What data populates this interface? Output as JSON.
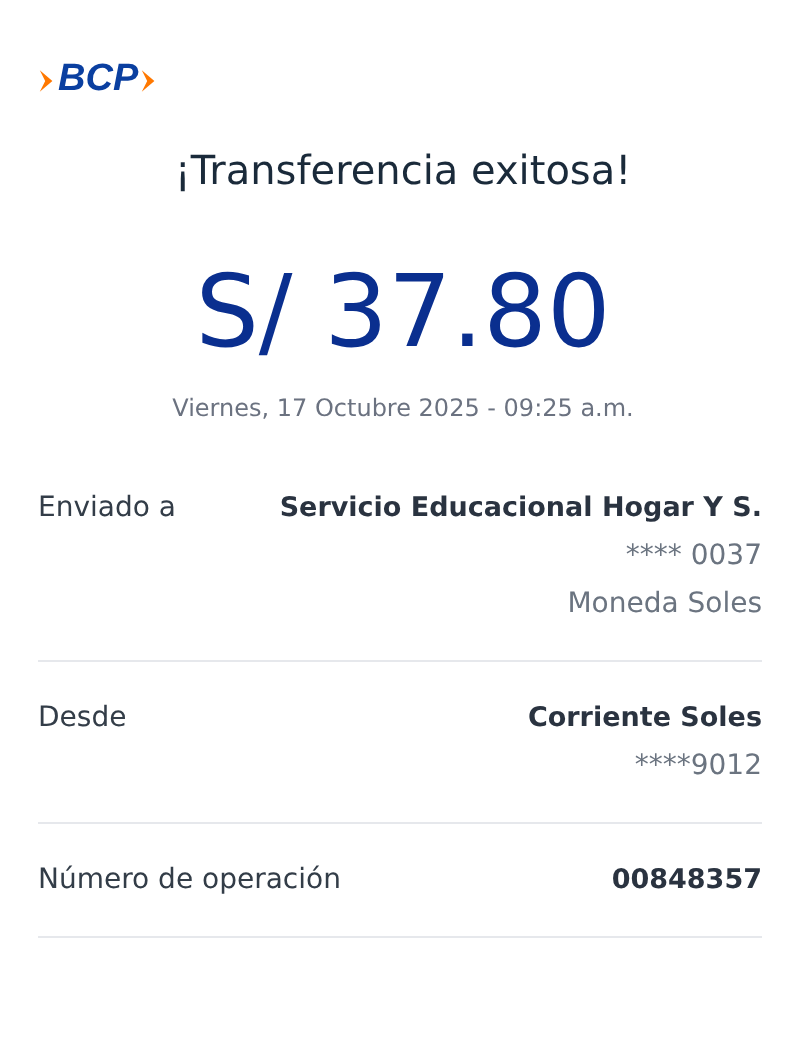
{
  "logo": {
    "text": "BCP"
  },
  "title": "¡Transferencia exitosa!",
  "amount": "S/ 37.80",
  "datetime": "Viernes, 17 Octubre 2025 - 09:25 a.m.",
  "details": [
    {
      "label": "Enviado a",
      "values": [
        "Servicio Educacional Hogar Y S.",
        "**** 0037",
        "Moneda Soles"
      ]
    },
    {
      "label": "Desde",
      "values": [
        "Corriente Soles",
        "****9012"
      ]
    },
    {
      "label": "Número de operación",
      "values": [
        "00848357"
      ]
    }
  ]
}
